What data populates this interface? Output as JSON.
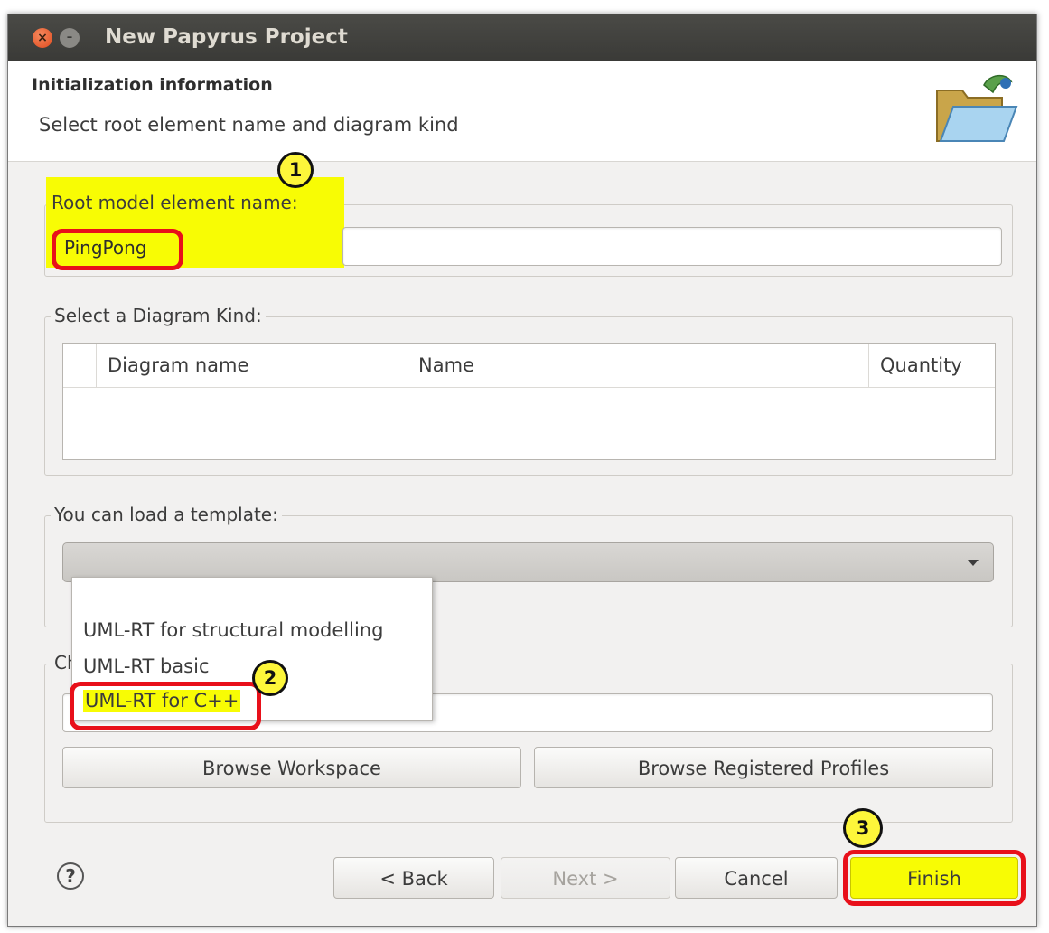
{
  "window": {
    "title": "New Papyrus Project",
    "close_glyph": "×",
    "minimize_glyph": "–"
  },
  "header": {
    "title": "Initialization information",
    "subtitle": "Select root element name and diagram kind",
    "icon": "open-folder-icon"
  },
  "root_group": {
    "legend": "Root model element name:",
    "value": "PingPong"
  },
  "diagram_group": {
    "legend": "Select a Diagram Kind:",
    "columns": [
      "",
      "Diagram name",
      "Name",
      "Quantity"
    ]
  },
  "template_group": {
    "legend": "You can load a template:",
    "selected": "",
    "options": [
      "UML-RT for structural modelling",
      "UML-RT basic",
      "UML-RT for C++"
    ],
    "highlighted_option": "UML-RT for C++"
  },
  "profile_group": {
    "legend_visible": "Ch",
    "value": "",
    "browse_workspace": "Browse Workspace",
    "browse_profiles": "Browse Registered Profiles"
  },
  "footer": {
    "help_glyph": "?",
    "back": "< Back",
    "next": "Next >",
    "cancel": "Cancel",
    "finish": "Finish"
  },
  "callouts": [
    "1",
    "2",
    "3"
  ],
  "colors": {
    "highlight": "#f8fc04",
    "callout_border": "#e8101a",
    "titlebar": "#3c3b37",
    "close_button": "#e9541f"
  }
}
